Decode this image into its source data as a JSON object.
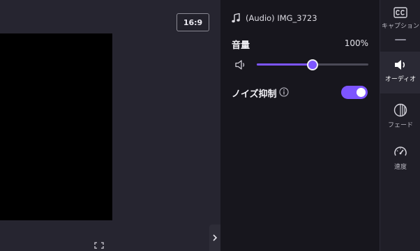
{
  "preview": {
    "aspect_ratio": "16:9"
  },
  "panel": {
    "clip_name": "(Audio) IMG_3723",
    "volume": {
      "label": "音量",
      "value_text": "100%",
      "level": 0.5
    },
    "noise_suppression": {
      "label": "ノイズ抑制",
      "enabled": true
    }
  },
  "rail": {
    "items": [
      {
        "label": "キャプション",
        "icon": "captions-icon"
      },
      {
        "label": "オーディオ",
        "icon": "speaker-icon"
      },
      {
        "label": "フェード",
        "icon": "fade-icon"
      },
      {
        "label": "速度",
        "icon": "speed-gauge-icon"
      }
    ],
    "active_index": 1
  },
  "colors": {
    "accent": "#7d55ff",
    "panel_bg": "#17161d",
    "preview_bg": "#262530"
  }
}
